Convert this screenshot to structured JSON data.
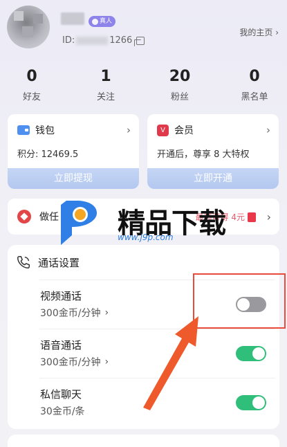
{
  "profile": {
    "badge": "真人",
    "uid_prefix": "ID:",
    "uid_suffix": "1266",
    "homepage_link": "我的主页 ›"
  },
  "stats": [
    {
      "value": "0",
      "label": "好友"
    },
    {
      "value": "1",
      "label": "关注"
    },
    {
      "value": "20",
      "label": "粉丝"
    },
    {
      "value": "0",
      "label": "黑名单"
    }
  ],
  "wallet": {
    "title": "钱包",
    "points": "积分: 12469.5",
    "action": "立即提现"
  },
  "vip": {
    "title": "会员",
    "desc": "开通后，尊享 8 大特权",
    "action": "立即开通"
  },
  "task": {
    "text": "做任",
    "reward": "最高可得 4元"
  },
  "watermark": {
    "text": "精品下载",
    "url": "www.j9p.com"
  },
  "call_settings": {
    "title": "通话设置",
    "items": [
      {
        "name": "视频通话",
        "price": "300金币/分钟",
        "enabled": false
      },
      {
        "name": "语音通话",
        "price": "300金币/分钟",
        "enabled": true
      },
      {
        "name": "私信聊天",
        "price": "30金币/条",
        "enabled": true
      }
    ]
  },
  "colors": {
    "accent_purple": "#8e83ea",
    "toggle_on": "#2fbf7a",
    "toggle_off": "#9a9a9e",
    "highlight_box": "#e84a3c"
  }
}
